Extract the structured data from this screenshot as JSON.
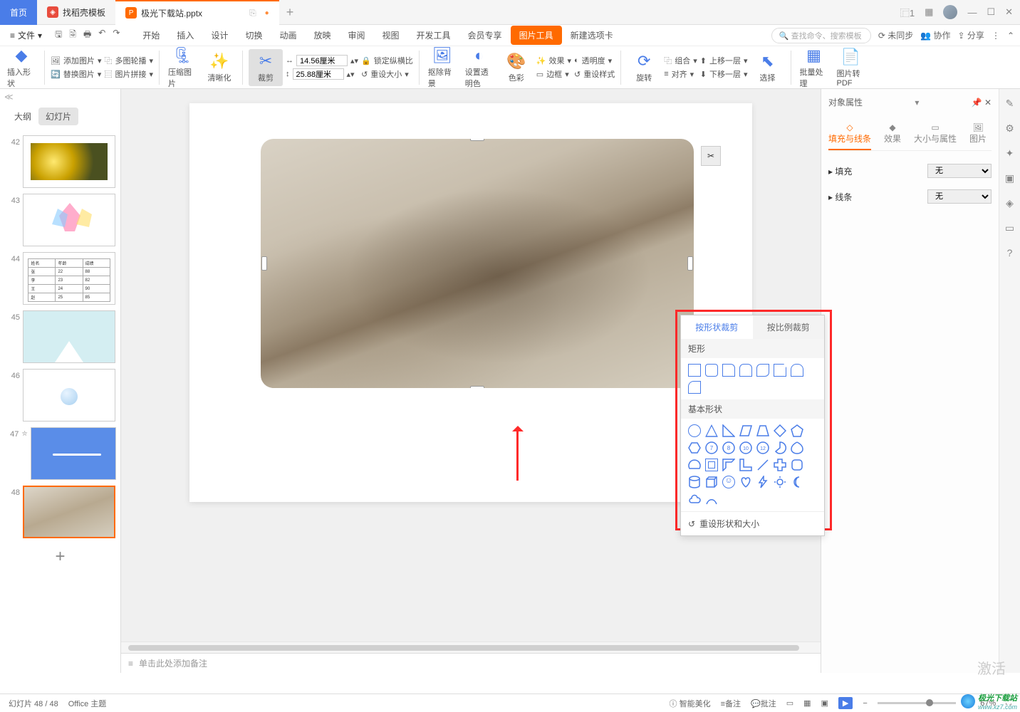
{
  "tabs": {
    "home": "首页",
    "template": "找稻壳模板",
    "doc": "极光下载站.pptx"
  },
  "menu": {
    "file": "文件",
    "items": [
      "开始",
      "插入",
      "设计",
      "切换",
      "动画",
      "放映",
      "审阅",
      "视图",
      "开发工具",
      "会员专享"
    ],
    "img_tools": "图片工具",
    "new_tab": "新建选项卡",
    "search_ph": "查找命令、搜索模板",
    "unsync": "未同步",
    "collab": "协作",
    "share": "分享"
  },
  "ribbon": {
    "insert_shape": "插入形状",
    "add_pic": "添加图片",
    "multi_outline": "多图轮播",
    "replace_pic": "替换图片",
    "pic_join": "图片拼接",
    "compress": "压缩图片",
    "clarity": "清晰化",
    "crop": "裁剪",
    "w": "14.56厘米",
    "h": "25.88厘米",
    "lock_ratio": "锁定纵横比",
    "reset_size": "重设大小",
    "remove_bg": "抠除背景",
    "set_trans": "设置透明色",
    "color": "色彩",
    "effect": "效果",
    "trans": "透明度",
    "border": "边框",
    "reset_style": "重设样式",
    "rotate": "旋转",
    "group": "组合",
    "align": "对齐",
    "up_layer": "上移一层",
    "down_layer": "下移一层",
    "select": "选择",
    "batch": "批量处理",
    "to_pdf": "图片转PDF"
  },
  "side": {
    "outline": "大纲",
    "slides": "幻灯片"
  },
  "slide_nums": [
    "42",
    "43",
    "44",
    "45",
    "46",
    "47",
    "48"
  ],
  "notes_ph": "单击此处添加备注",
  "right_panel": {
    "title": "对象属性",
    "t1": "填充与线条",
    "t2": "效果",
    "t3": "大小与属性",
    "t4": "图片",
    "fill": "填充",
    "line": "线条",
    "none": "无"
  },
  "popup": {
    "tab1": "按形状裁剪",
    "tab2": "按比例裁剪",
    "rect": "矩形",
    "basic": "基本形状",
    "reset": "重设形状和大小"
  },
  "status": {
    "pages": "幻灯片 48 / 48",
    "theme": "Office 主题",
    "beautify": "智能美化",
    "notes": "备注",
    "comment": "批注",
    "zoom": "67%"
  },
  "watermark": "激活",
  "site": "极光下载站",
  "site_url": "www.xz7.com"
}
